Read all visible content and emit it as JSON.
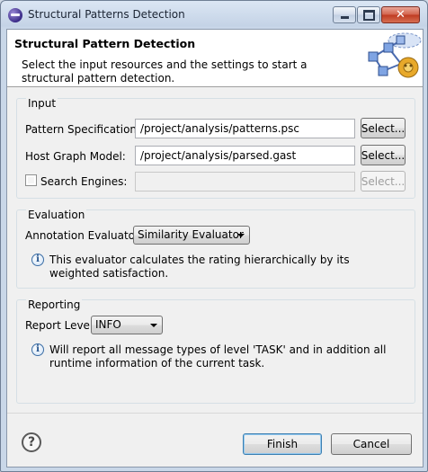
{
  "window": {
    "title": "Structural Patterns Detection"
  },
  "banner": {
    "title": "Structural Pattern Detection",
    "description": "Select the input resources and the settings to start a structural pattern detection."
  },
  "input": {
    "group_title": "Input",
    "pattern_spec": {
      "label": "Pattern Specifications:",
      "value": "/project/analysis/patterns.psc",
      "button": "Select..."
    },
    "host_graph": {
      "label": "Host Graph Model:",
      "value": "/project/analysis/parsed.gast",
      "button": "Select..."
    },
    "search_engines": {
      "label": "Search Engines:",
      "checked": false,
      "value": "",
      "button": "Select..."
    }
  },
  "evaluation": {
    "group_title": "Evaluation",
    "evaluator_label": "Annotation Evaluator:",
    "evaluator_value": "Similarity Evaluator",
    "info": "This evaluator calculates the rating hierarchically by its weighted satisfaction."
  },
  "reporting": {
    "group_title": "Reporting",
    "level_label": "Report Level:",
    "level_value": "INFO",
    "info": "Will report all message types of level 'TASK' and in addition all runtime information of the current task."
  },
  "footer": {
    "help_icon": "help-icon",
    "finish": "Finish",
    "cancel": "Cancel"
  },
  "colors": {
    "title_bar": "#c4d3e6",
    "client_bg": "#f0f0f0",
    "close_button": "#c9452a",
    "info_icon": "#1f4f8a"
  }
}
